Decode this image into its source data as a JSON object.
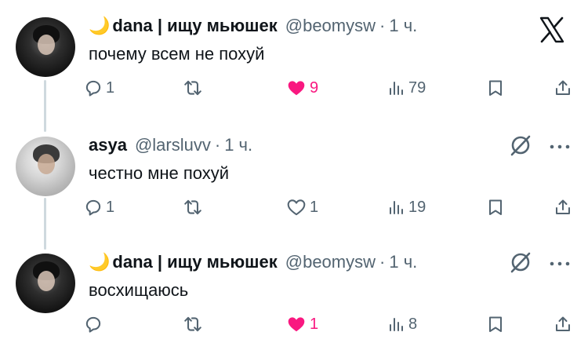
{
  "thread": {
    "tweets": [
      {
        "author_prefix": "🌙",
        "name": "dana | ищу мьюшек",
        "handle": "@beomysw",
        "sep": "·",
        "time": "1 ч.",
        "text": "почему всем не похуй",
        "replies": "1",
        "retweets": "",
        "likes": "9",
        "liked": true,
        "views": "79"
      },
      {
        "author_prefix": "",
        "name": "asya",
        "handle": "@larsluvv",
        "sep": "·",
        "time": "1 ч.",
        "text": "честно мне похуй",
        "replies": "1",
        "retweets": "",
        "likes": "1",
        "liked": false,
        "views": "19"
      },
      {
        "author_prefix": "🌙",
        "name": "dana | ищу мьюшек",
        "handle": "@beomysw",
        "sep": "·",
        "time": "1 ч.",
        "text": "восхищаюсь",
        "replies": "",
        "retweets": "",
        "likes": "1",
        "liked": true,
        "views": "8"
      }
    ]
  },
  "colors": {
    "text": "#0f1419",
    "secondary": "#536471",
    "like": "#f91880",
    "thread_line": "#cfd9de"
  },
  "icons": [
    "x-logo-icon",
    "reply-icon",
    "retweet-icon",
    "like-icon",
    "views-icon",
    "bookmark-icon",
    "share-icon",
    "translate-icon",
    "more-icon"
  ]
}
